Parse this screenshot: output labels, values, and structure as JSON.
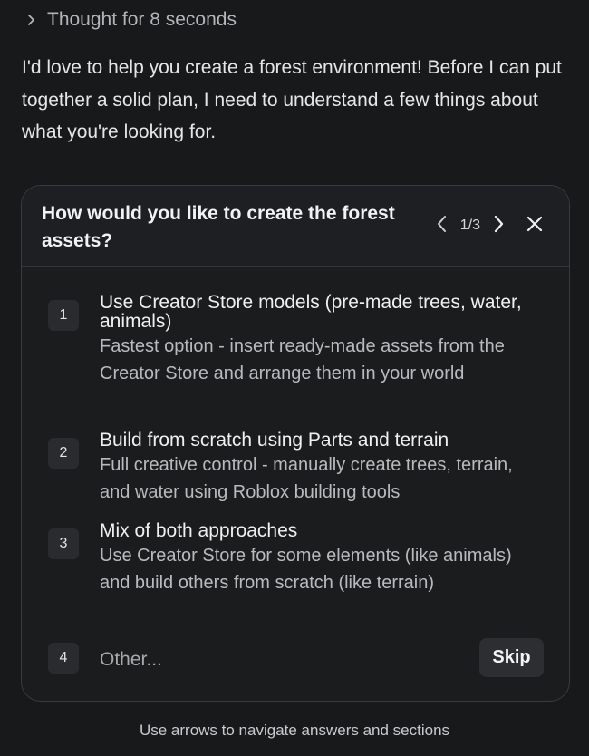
{
  "thought": {
    "label": "Thought for 8 seconds"
  },
  "intro": {
    "text": "I'd love to help you create a forest environment! Before I can put together a solid plan, I need to understand a few things about what you're looking for."
  },
  "card": {
    "question": "How would you like to create the forest assets?",
    "counter": "1/3",
    "options": [
      {
        "number": "1",
        "title": "Use Creator Store models (pre-made trees, water, animals)",
        "description": "Fastest option - insert ready-made assets from the Creator Store and arrange them in your world"
      },
      {
        "number": "2",
        "title": "Build from scratch using Parts and terrain",
        "description": "Full creative control - manually create trees, terrain, and water using Roblox building tools"
      },
      {
        "number": "3",
        "title": "Mix of both approaches",
        "description": "Use Creator Store for some elements (like animals) and build others from scratch (like terrain)"
      },
      {
        "number": "4",
        "title": "Other..."
      }
    ],
    "skip_label": "Skip"
  },
  "hint": {
    "text": "Use arrows to navigate answers and sections"
  },
  "icons": {
    "thought_toggle": "chevron-right-icon",
    "prev": "chevron-left-icon",
    "next": "chevron-right-icon",
    "close": "close-icon"
  },
  "colors": {
    "background": "#18191b",
    "card_background": "#1b1c1e",
    "card_border": "#3a3b3f",
    "number_badge": "#2a2b2f",
    "skip_button": "#2d2e32"
  }
}
